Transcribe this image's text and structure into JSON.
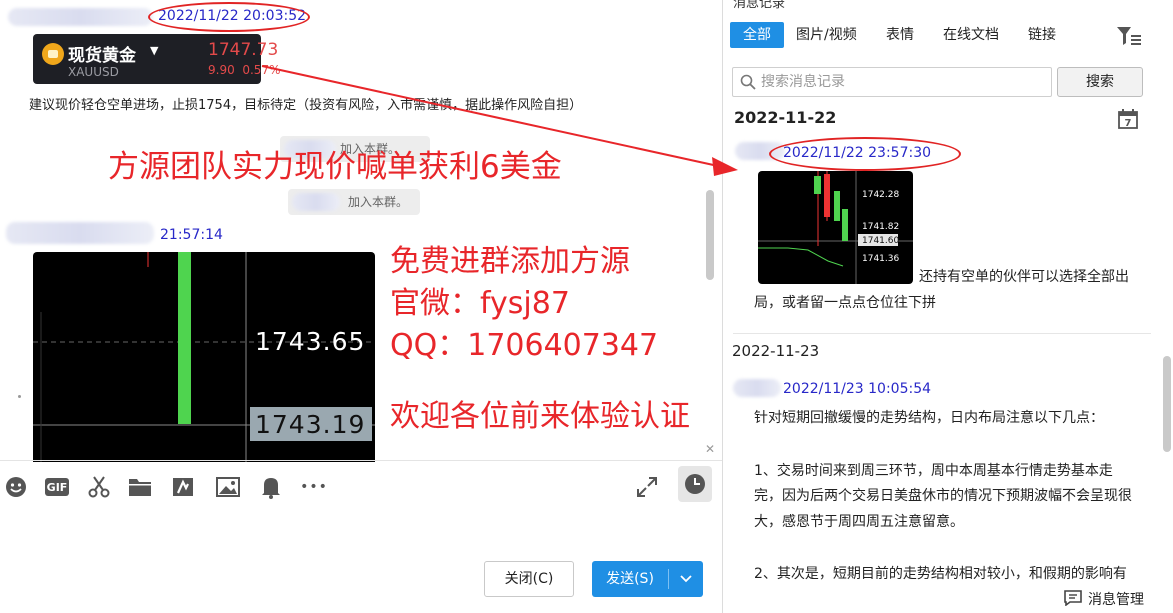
{
  "chat": {
    "msg1_time": "2022/11/22 20:03:52",
    "gold_card": {
      "name": "现货黄金",
      "code": "XAUUSD",
      "price": "1747.73",
      "change": "9.90",
      "change_pct": "0.57%"
    },
    "msg1_text": "建议现价轻仓空单进场，止损1754，目标待定（投资有风险，入市需谨慎，据此操作风险自担）",
    "system_join_1": "加入本群。",
    "system_join_2": "加入本群。",
    "promo_title": "方源团队实力现价喊单获利6美金",
    "msg2_time": "21:57:14",
    "chart_big": {
      "price_label_1": "1743.65",
      "price_label_2": "1743.19"
    },
    "promo_lines": {
      "line1": "免费进群添加方源",
      "line2": "官微：fysj87",
      "line3": "QQ：1706407347",
      "line4": "欢迎各位前来体验认证"
    },
    "close_x": "✕",
    "toolbar_more": "•••",
    "buttons": {
      "close": "关闭(C)",
      "send": "发送(S)"
    }
  },
  "history": {
    "title": "消息记录",
    "tabs": [
      "全部",
      "图片/视频",
      "表情",
      "在线文档",
      "链接"
    ],
    "search_placeholder": "搜索消息记录",
    "search_button": "搜索",
    "date_1": "2022-11-22",
    "calendar_day": "7",
    "r1_time": "2022/11/22 23:57:30",
    "chart_small": {
      "tick_1": "1742.28",
      "tick_2": "1741.82",
      "tick_current": "1741.60",
      "tick_3": "1741.36"
    },
    "r1_text_a": "还持有空单的伙伴可以选择全部出",
    "r1_text_b": "局，或者留一点点仓位往下拼",
    "date_2": "2022-11-23",
    "r2_time": "2022/11/23 10:05:54",
    "r2_lines": [
      "针对短期回撤缓慢的走势结构，日内布局注意以下几点：",
      "1、交易时间来到周三环节，周中本周基本行情走势基本走",
      "完，因为后两个交易日美盘休市的情况下预期波幅不会呈现很",
      "大，感恩节于周四周五注意留意。",
      "2、其次是，短期目前的走势结构相对较小，和假期的影响有"
    ],
    "manage_label": "消息管理"
  },
  "colors": {
    "accent_blue": "#1f8fe4",
    "annotation_red": "#e8262a",
    "timestamp_blue": "#2828c8"
  }
}
